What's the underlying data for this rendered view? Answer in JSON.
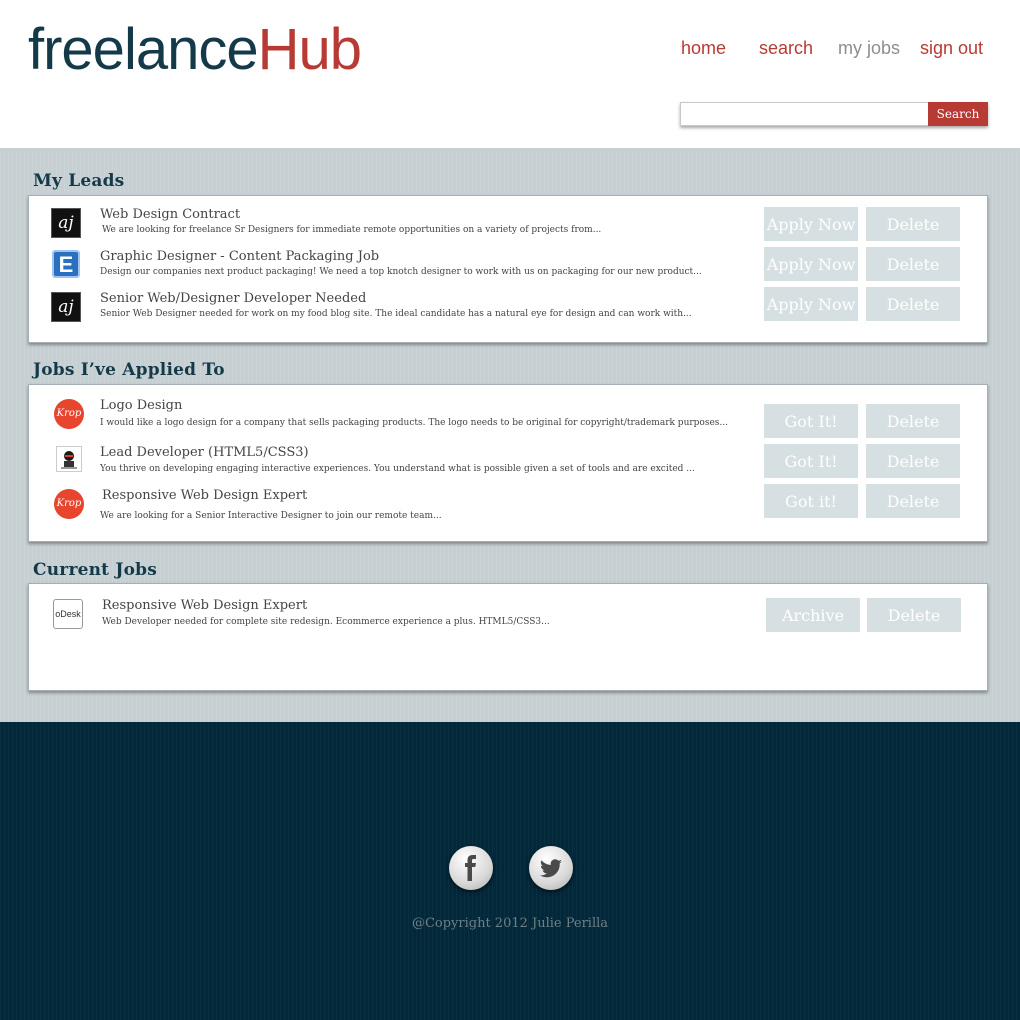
{
  "brand": {
    "part1": "freelance",
    "part2": "Hub"
  },
  "nav": {
    "home": "home",
    "search": "search",
    "my_jobs": "my jobs",
    "sign_out": "sign out",
    "active": "my jobs"
  },
  "search": {
    "value": "",
    "placeholder": "",
    "button": "Search"
  },
  "sections": {
    "leads": {
      "title": "My Leads",
      "rows": [
        {
          "icon": "aj-logo-icon",
          "title": "Web Design Contract",
          "desc": "We are looking for freelance Sr Designers for immediate  remote opportunities  on a variety of projects from...",
          "primary": "Apply Now",
          "delete": "Delete"
        },
        {
          "icon": "elance-logo-icon",
          "title": "Graphic Designer - Content Packaging Job",
          "desc": "Design our companies next product packaging! We need a top knotch designer to work with us on packaging for our new product...",
          "primary": "Apply Now",
          "delete": "Delete"
        },
        {
          "icon": "aj-logo-icon",
          "title": "Senior Web/Designer Developer Needed",
          "desc": "Senior Web Designer needed for work on my food blog site. The ideal candidate has a natural eye for design and can work with...",
          "primary": "Apply Now",
          "delete": "Delete"
        }
      ]
    },
    "applied": {
      "title": "Jobs I’ve Applied To",
      "rows": [
        {
          "icon": "krop-logo-icon",
          "title": "Logo Design",
          "desc": "I would like a logo design for a company that sells packaging products. The logo needs to be original for copyright/trademark purposes...",
          "primary": "Got It!",
          "delete": "Delete"
        },
        {
          "icon": "ninja-logo-icon",
          "title": "Lead Developer (HTML5/CSS3)",
          "desc": "You thrive on developing engaging interactive experiences. You understand what is possible given a set of tools and are excited ...",
          "primary": "Got It!",
          "delete": "Delete"
        },
        {
          "icon": "krop-logo-icon",
          "title": "Responsive Web Design Expert",
          "desc": "We are looking for a Senior Interactive Designer to join our remote team...",
          "primary": "Got it!",
          "delete": "Delete"
        }
      ]
    },
    "current": {
      "title": "Current Jobs",
      "rows": [
        {
          "icon": "odesk-logo-icon",
          "title": "Responsive Web Design Expert",
          "desc": "Web Developer needed for complete site redesign. Ecommerce experience a plus. HTML5/CSS3...",
          "primary": "Archive",
          "delete": "Delete"
        }
      ]
    }
  },
  "icon_text": {
    "aj": "aj",
    "elance": "E",
    "krop": "Krop",
    "odesk": "oDesk"
  },
  "footer": {
    "facebook_icon": "facebook-icon",
    "twitter_icon": "twitter-icon",
    "copyright": "@Copyright 2012 Julie Perilla"
  },
  "colors": {
    "navy": "#143a4a",
    "red": "#b83a34",
    "button_bg": "#d6e0e2",
    "footer_bg": "#02283a"
  }
}
